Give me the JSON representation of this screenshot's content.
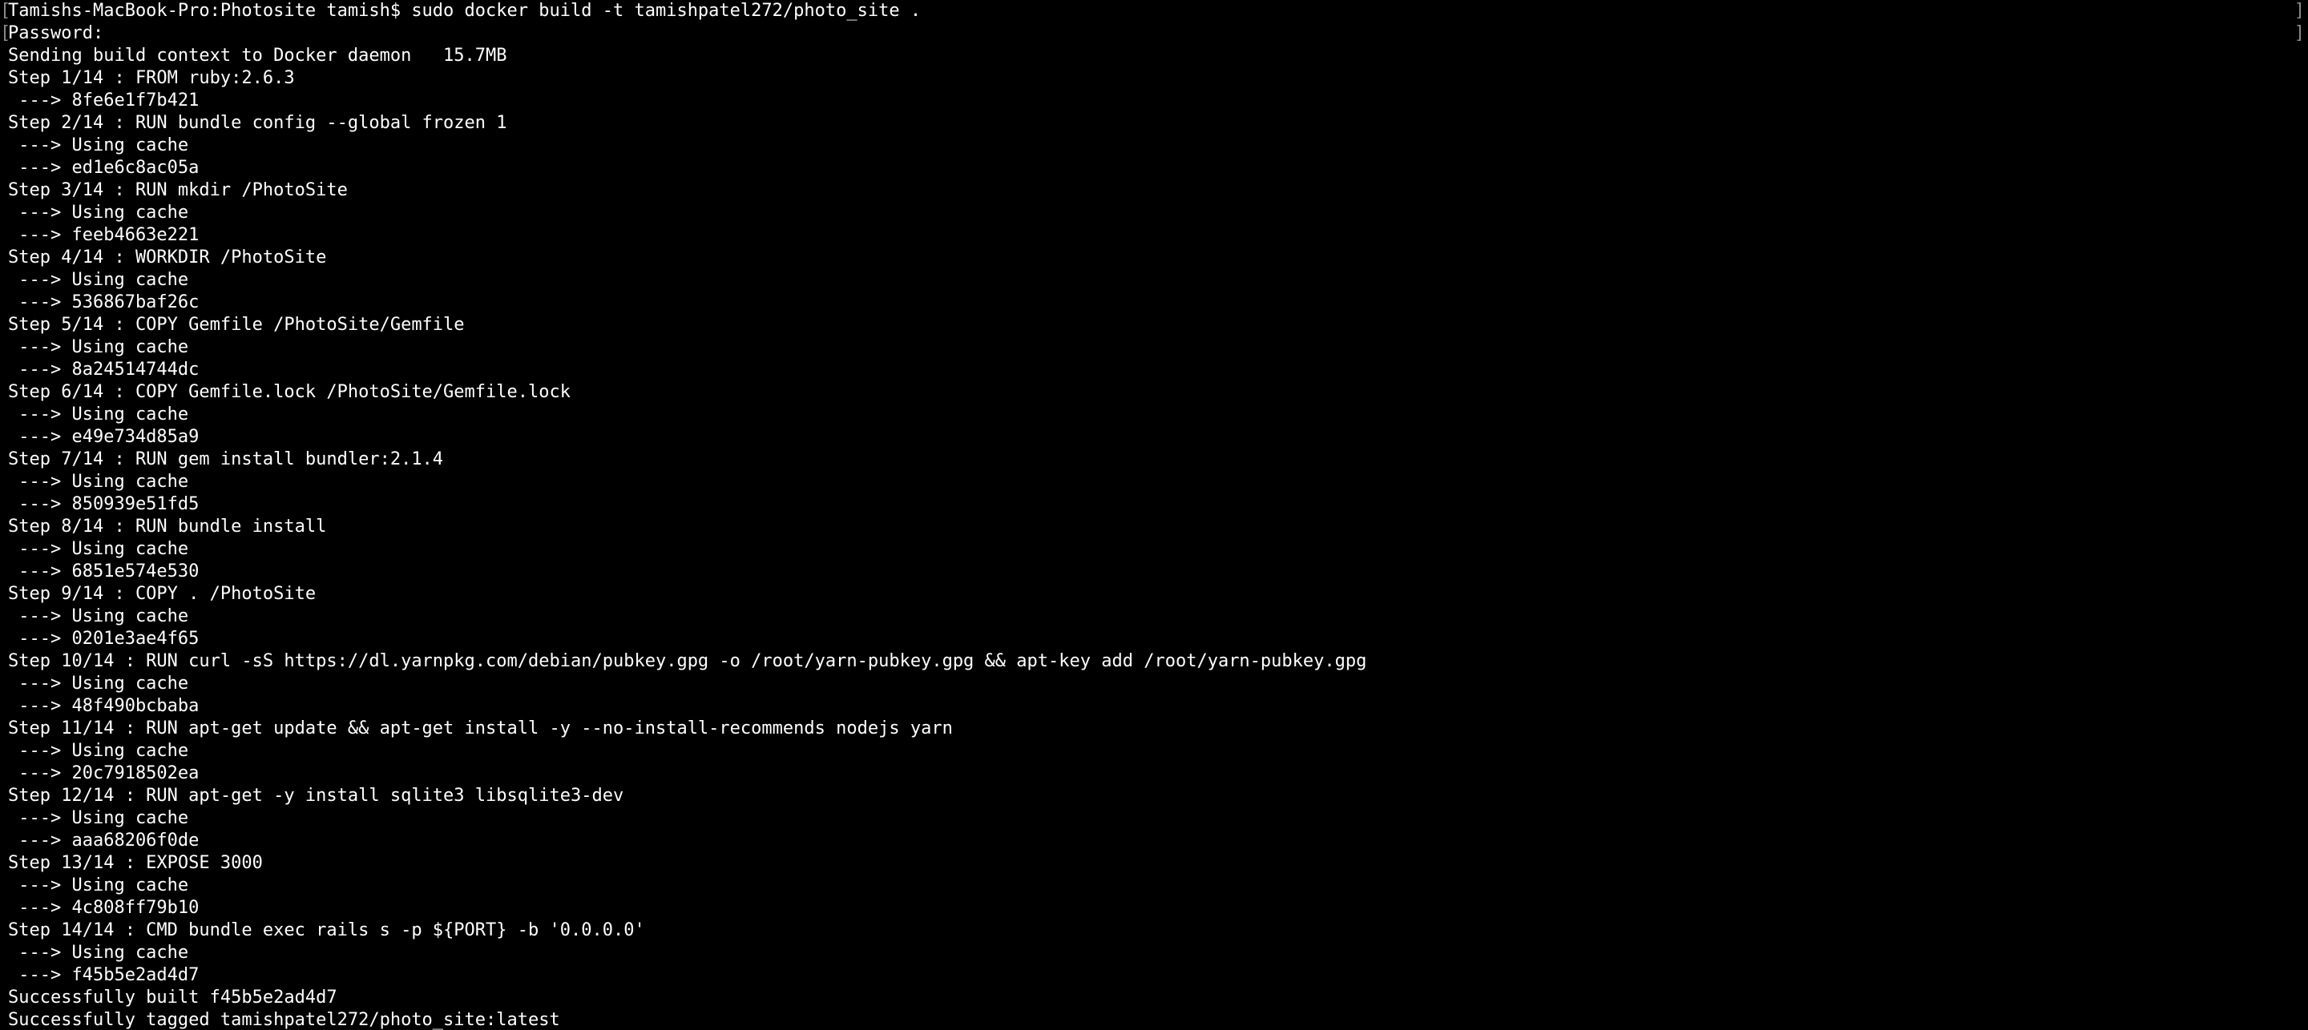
{
  "terminal": {
    "lines": [
      "Tamishs-MacBook-Pro:Photosite tamish$ sudo docker build -t tamishpatel272/photo_site .",
      "Password:",
      "Sending build context to Docker daemon   15.7MB",
      "Step 1/14 : FROM ruby:2.6.3",
      " ---> 8fe6e1f7b421",
      "Step 2/14 : RUN bundle config --global frozen 1",
      " ---> Using cache",
      " ---> ed1e6c8ac05a",
      "Step 3/14 : RUN mkdir /PhotoSite",
      " ---> Using cache",
      " ---> feeb4663e221",
      "Step 4/14 : WORKDIR /PhotoSite",
      " ---> Using cache",
      " ---> 536867baf26c",
      "Step 5/14 : COPY Gemfile /PhotoSite/Gemfile",
      " ---> Using cache",
      " ---> 8a24514744dc",
      "Step 6/14 : COPY Gemfile.lock /PhotoSite/Gemfile.lock",
      " ---> Using cache",
      " ---> e49e734d85a9",
      "Step 7/14 : RUN gem install bundler:2.1.4",
      " ---> Using cache",
      " ---> 850939e51fd5",
      "Step 8/14 : RUN bundle install",
      " ---> Using cache",
      " ---> 6851e574e530",
      "Step 9/14 : COPY . /PhotoSite",
      " ---> Using cache",
      " ---> 0201e3ae4f65",
      "Step 10/14 : RUN curl -sS https://dl.yarnpkg.com/debian/pubkey.gpg -o /root/yarn-pubkey.gpg && apt-key add /root/yarn-pubkey.gpg",
      " ---> Using cache",
      " ---> 48f490bcbaba",
      "Step 11/14 : RUN apt-get update && apt-get install -y --no-install-recommends nodejs yarn",
      " ---> Using cache",
      " ---> 20c7918502ea",
      "Step 12/14 : RUN apt-get -y install sqlite3 libsqlite3-dev",
      " ---> Using cache",
      " ---> aaa68206f0de",
      "Step 13/14 : EXPOSE 3000",
      " ---> Using cache",
      " ---> 4c808ff79b10",
      "Step 14/14 : CMD bundle exec rails s -p ${PORT} -b '0.0.0.0'",
      " ---> Using cache",
      " ---> f45b5e2ad4d7",
      "Successfully built f45b5e2ad4d7",
      "Successfully tagged tamishpatel272/photo_site:latest"
    ]
  },
  "colors": {
    "background": "#000000",
    "text": "#ffffff",
    "bracket": "#8a8a8a"
  }
}
